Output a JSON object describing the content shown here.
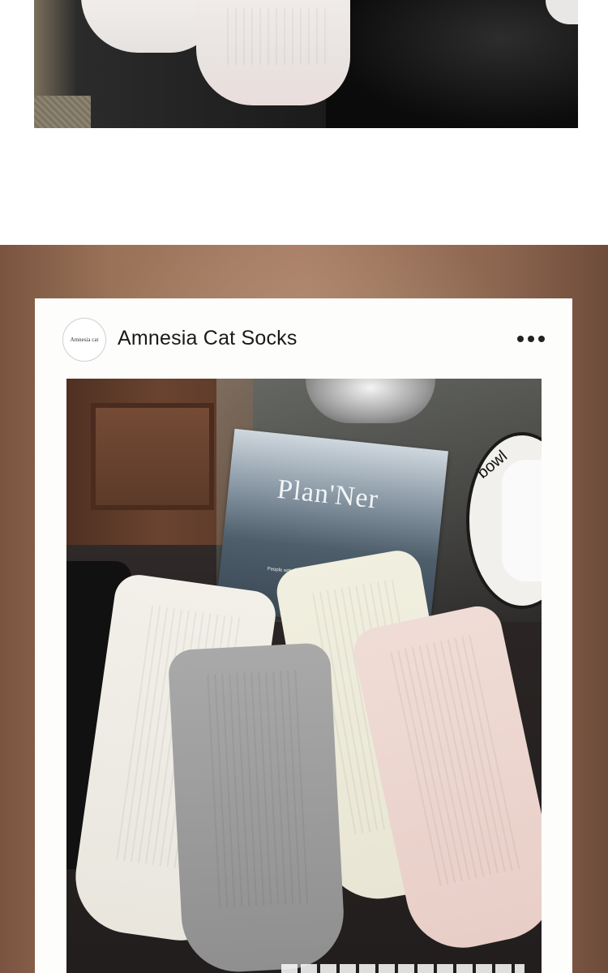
{
  "card": {
    "avatar_text": "Amnesia cat",
    "brand_name": "Amnesia Cat Socks",
    "menu_icon": "more-horizontal-icon"
  },
  "photo": {
    "magazine_title": "Plan'Ner",
    "magazine_caption": "People with plan...",
    "bowl_label": "bowl"
  },
  "colors": {
    "card_background": "#fdfdfc",
    "banner_background": "#9a7258",
    "text_primary": "#1a1a1a"
  }
}
